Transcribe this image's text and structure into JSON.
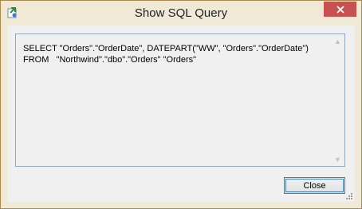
{
  "window": {
    "title": "Show SQL Query",
    "close_glyph": "✕",
    "app_icon": "query-app-icon"
  },
  "query": {
    "line1": "SELECT \"Orders\".\"OrderDate\", DATEPART(\"WW\", \"Orders\".\"OrderDate\")",
    "line2": "FROM   \"Northwind\".\"dbo\".\"Orders\" \"Orders\""
  },
  "scrollbar": {
    "up_glyph": "▲",
    "down_glyph": "▼"
  },
  "buttons": {
    "close_label": "Close"
  },
  "colors": {
    "frame": "#f0e9d6",
    "close_button": "#c75050",
    "focus_border": "#8fa7c7"
  }
}
